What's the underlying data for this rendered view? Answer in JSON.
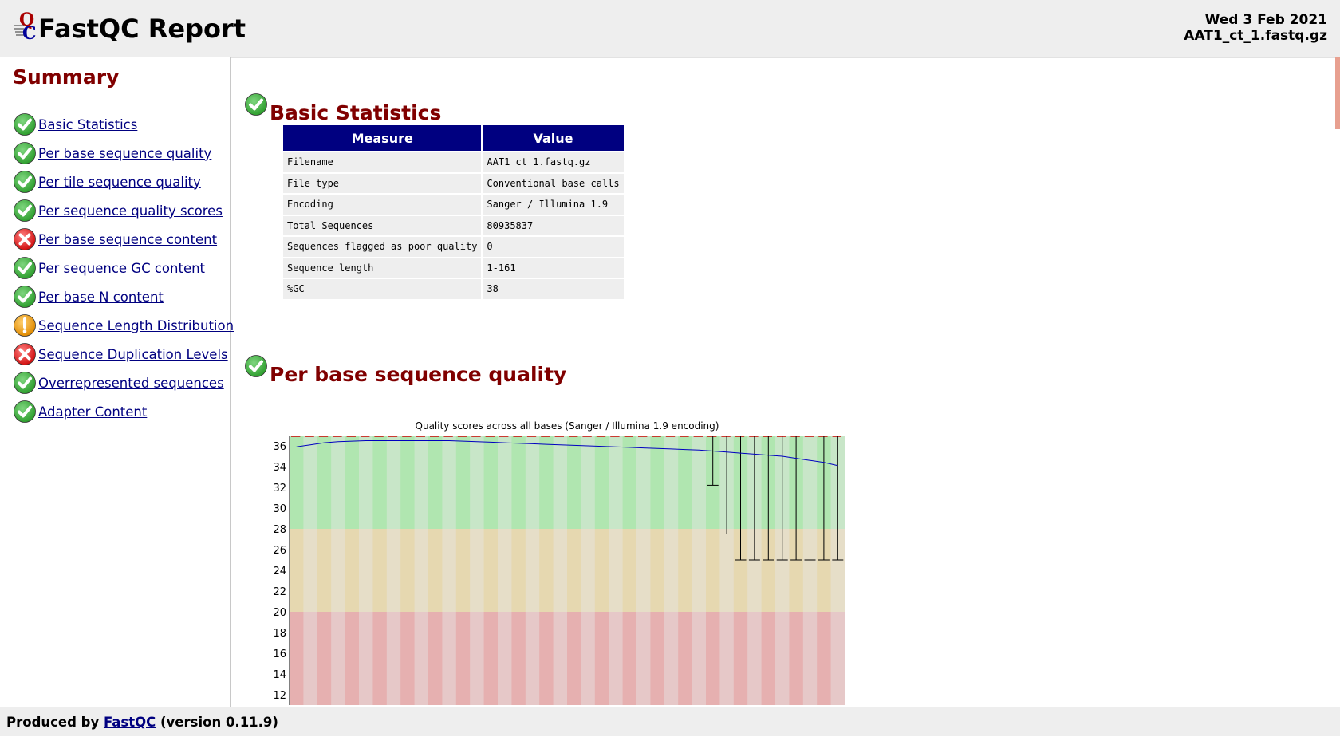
{
  "header": {
    "title": "FastQC Report",
    "date": "Wed 3 Feb 2021",
    "filename": "AAT1_ct_1.fastq.gz"
  },
  "sidebar": {
    "title": "Summary",
    "items": [
      {
        "label": "Basic Statistics",
        "status": "pass"
      },
      {
        "label": "Per base sequence quality",
        "status": "pass"
      },
      {
        "label": "Per tile sequence quality",
        "status": "pass"
      },
      {
        "label": "Per sequence quality scores",
        "status": "pass"
      },
      {
        "label": "Per base sequence content",
        "status": "fail"
      },
      {
        "label": "Per sequence GC content",
        "status": "pass"
      },
      {
        "label": "Per base N content",
        "status": "pass"
      },
      {
        "label": "Sequence Length Distribution",
        "status": "warn"
      },
      {
        "label": "Sequence Duplication Levels",
        "status": "fail"
      },
      {
        "label": "Overrepresented sequences",
        "status": "pass"
      },
      {
        "label": "Adapter Content",
        "status": "pass"
      }
    ]
  },
  "basic_stats": {
    "title": "Basic Statistics",
    "headers": [
      "Measure",
      "Value"
    ],
    "rows": [
      [
        "Filename",
        "AAT1_ct_1.fastq.gz"
      ],
      [
        "File type",
        "Conventional base calls"
      ],
      [
        "Encoding",
        "Sanger / Illumina 1.9"
      ],
      [
        "Total Sequences",
        "80935837"
      ],
      [
        "Sequences flagged as poor quality",
        "0"
      ],
      [
        "Sequence length",
        "1-161"
      ],
      [
        "%GC",
        "38"
      ]
    ]
  },
  "per_base_quality": {
    "title": "Per base sequence quality"
  },
  "chart_data": {
    "type": "line",
    "title": "Quality scores across all bases (Sanger / Illumina 1.9 encoding)",
    "xlabel": "",
    "ylabel": "",
    "ylim": [
      11,
      37
    ],
    "yticks": [
      12,
      14,
      16,
      18,
      20,
      22,
      24,
      26,
      28,
      30,
      32,
      34,
      36
    ],
    "zones": [
      {
        "from": 28,
        "to": 37,
        "label": "good",
        "colors": [
          "#b0e6b0",
          "#c8e6c8"
        ]
      },
      {
        "from": 20,
        "to": 28,
        "label": "reasonable",
        "colors": [
          "#e6d8b0",
          "#e6dec8"
        ]
      },
      {
        "from": 0,
        "to": 20,
        "label": "poor",
        "colors": [
          "#e6b0b0",
          "#e6c8c8"
        ]
      }
    ],
    "n_bins": 40,
    "mean": [
      35.9,
      36.1,
      36.3,
      36.4,
      36.45,
      36.5,
      36.5,
      36.5,
      36.5,
      36.5,
      36.5,
      36.5,
      36.45,
      36.4,
      36.35,
      36.3,
      36.25,
      36.2,
      36.15,
      36.1,
      36.05,
      36.0,
      35.95,
      35.9,
      35.85,
      35.8,
      35.75,
      35.7,
      35.65,
      35.6,
      35.5,
      35.4,
      35.3,
      35.2,
      35.1,
      35.0,
      34.8,
      34.6,
      34.4,
      34.1
    ],
    "whiskers": [
      {
        "bin": 30,
        "low": 32.2,
        "high": 37
      },
      {
        "bin": 31,
        "low": 27.5,
        "high": 37
      },
      {
        "bin": 32,
        "low": 25.0,
        "high": 37
      },
      {
        "bin": 33,
        "low": 25.0,
        "high": 37
      },
      {
        "bin": 34,
        "low": 25.0,
        "high": 37
      },
      {
        "bin": 35,
        "low": 25.0,
        "high": 37
      },
      {
        "bin": 36,
        "low": 25.0,
        "high": 37
      },
      {
        "bin": 37,
        "low": 25.0,
        "high": 37
      },
      {
        "bin": 38,
        "low": 25.0,
        "high": 37
      },
      {
        "bin": 39,
        "low": 25.0,
        "high": 37
      }
    ],
    "line_color": "#0000c0",
    "median_color": "#cc0000"
  },
  "footer": {
    "prefix": "Produced by",
    "link": "FastQC",
    "version": "(version 0.11.9)"
  }
}
